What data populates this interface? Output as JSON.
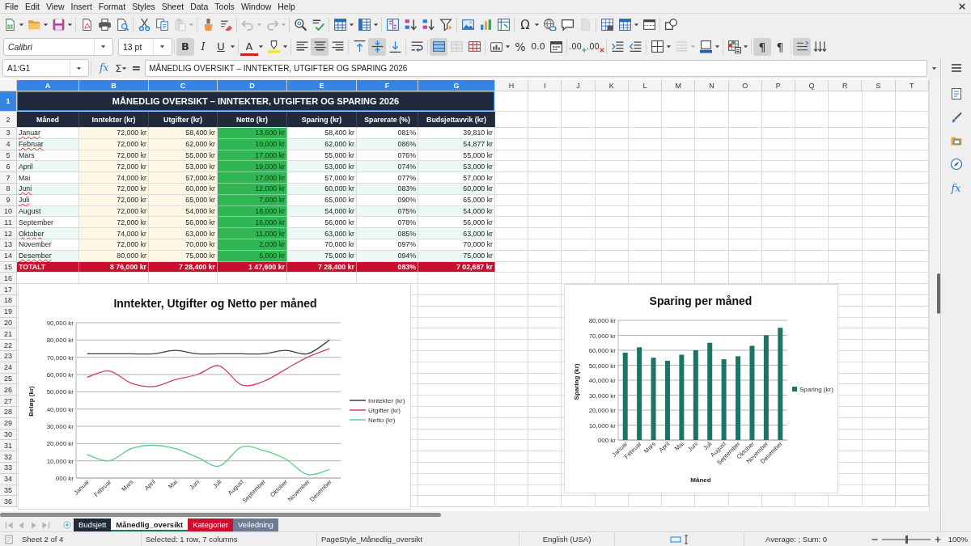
{
  "menu_bar": {
    "items": [
      "File",
      "Edit",
      "View",
      "Insert",
      "Format",
      "Styles",
      "Sheet",
      "Data",
      "Tools",
      "Window",
      "Help"
    ]
  },
  "standard_toolbar": {
    "groups": [
      [
        {
          "kind": "new",
          "dropdown": true,
          "disabled": false
        },
        {
          "kind": "open",
          "dropdown": true,
          "disabled": false
        },
        {
          "kind": "save",
          "dropdown": true,
          "disabled": false
        }
      ],
      [
        {
          "kind": "pdf",
          "disabled": false
        },
        {
          "kind": "print",
          "disabled": false
        },
        {
          "kind": "preview",
          "disabled": false
        }
      ],
      [
        {
          "kind": "cut",
          "disabled": false
        },
        {
          "kind": "copy",
          "disabled": false
        },
        {
          "kind": "paste",
          "dropdown": true,
          "disabled": true
        }
      ],
      [
        {
          "kind": "brush",
          "disabled": false
        },
        {
          "kind": "eraser",
          "disabled": false
        }
      ],
      [
        {
          "kind": "undo",
          "dropdown": true,
          "disabled": true
        },
        {
          "kind": "redo",
          "dropdown": true,
          "disabled": true
        }
      ],
      [
        {
          "kind": "find",
          "disabled": false
        },
        {
          "kind": "spelling",
          "disabled": false
        }
      ],
      [
        {
          "kind": "rows",
          "dropdown": true,
          "disabled": false
        },
        {
          "kind": "columns",
          "dropdown": true,
          "disabled": false
        }
      ],
      [
        {
          "kind": "sortaz",
          "disabled": false
        },
        {
          "kind": "ascending",
          "disabled": false
        },
        {
          "kind": "descending",
          "disabled": false
        },
        {
          "kind": "filter",
          "disabled": false
        }
      ],
      [
        {
          "kind": "image",
          "disabled": false
        },
        {
          "kind": "chart",
          "disabled": false
        },
        {
          "kind": "pivot",
          "disabled": false
        }
      ],
      [
        {
          "kind": "special",
          "label": "Ω",
          "dropdown": true,
          "disabled": false
        },
        {
          "kind": "link",
          "disabled": false
        },
        {
          "kind": "comment",
          "disabled": false
        },
        {
          "kind": "header",
          "disabled": true
        }
      ],
      [
        {
          "kind": "printarea",
          "disabled": false
        },
        {
          "kind": "freeze",
          "dropdown": true,
          "disabled": false
        },
        {
          "kind": "split",
          "disabled": false
        }
      ],
      [
        {
          "kind": "shapes",
          "disabled": false
        }
      ]
    ]
  },
  "formatting_toolbar": {
    "font_name": "Calibri",
    "font_size": "13 pt",
    "groups": [
      [
        {
          "kind": "bold",
          "label": "B",
          "on": true,
          "disabled": false
        },
        {
          "kind": "italic",
          "label": "I",
          "on": false,
          "disabled": false
        },
        {
          "kind": "underline",
          "label": "U",
          "dropdown": true,
          "on": false,
          "disabled": false
        }
      ],
      [
        {
          "kind": "fontcolor",
          "label": "A",
          "dropdown": true,
          "on": false,
          "disabled": false
        },
        {
          "kind": "highlight",
          "dropdown": true,
          "on": false,
          "disabled": false
        }
      ],
      [
        {
          "kind": "alignleft",
          "on": false,
          "disabled": false
        },
        {
          "kind": "aligncenter",
          "on": true,
          "disabled": false
        },
        {
          "kind": "alignright",
          "on": false,
          "disabled": false
        }
      ],
      [
        {
          "kind": "aligntop",
          "on": false,
          "disabled": false
        },
        {
          "kind": "alignmiddle",
          "on": true,
          "disabled": false
        },
        {
          "kind": "alignbottom",
          "on": false,
          "disabled": false
        }
      ],
      [
        {
          "kind": "wrap",
          "on": false,
          "disabled": false
        }
      ],
      [
        {
          "kind": "merge",
          "on": true,
          "disabled": false
        },
        {
          "kind": "mergecells",
          "on": false,
          "disabled": true
        },
        {
          "kind": "unmerge",
          "on": false,
          "disabled": false
        }
      ],
      [
        {
          "kind": "numformat",
          "dropdown": true,
          "on": false,
          "disabled": false
        },
        {
          "kind": "percent",
          "label": "%",
          "on": false,
          "disabled": false
        },
        {
          "kind": "standard",
          "label": "0.0",
          "on": false,
          "disabled": false
        },
        {
          "kind": "date",
          "on": false,
          "disabled": false
        }
      ],
      [
        {
          "kind": "adddecimal",
          "label": ".00",
          "on": false,
          "disabled": false
        },
        {
          "kind": "deletedecimal",
          "label": ".00",
          "on": false,
          "disabled": false
        }
      ],
      [
        {
          "kind": "indent",
          "on": false,
          "disabled": false
        },
        {
          "kind": "outdent",
          "on": false,
          "disabled": false
        }
      ],
      [
        {
          "kind": "borders",
          "dropdown": true,
          "on": false,
          "disabled": false
        },
        {
          "kind": "borderstyle",
          "dropdown": true,
          "on": false,
          "disabled": true
        },
        {
          "kind": "bordercolor",
          "dropdown": true,
          "on": false,
          "disabled": false
        }
      ],
      [
        {
          "kind": "conditional",
          "dropdown": true,
          "on": false,
          "disabled": false
        }
      ],
      [
        {
          "kind": "ltr",
          "label": "¶",
          "on": true,
          "disabled": false
        },
        {
          "kind": "rtl",
          "label": "¶",
          "on": false,
          "disabled": false
        }
      ],
      [
        {
          "kind": "textdir",
          "on": true,
          "disabled": false
        },
        {
          "kind": "vertical",
          "on": false,
          "disabled": false
        }
      ]
    ]
  },
  "formula_bar": {
    "name_box": "A1:G1",
    "function_wizard": "fx",
    "sum": "Σ",
    "equals": "=",
    "content": "MÅNEDLIG OVERSIKT – INNTEKTER, UTGIFTER OG SPARING 2026"
  },
  "sidebar": {
    "buttons": [
      {
        "kind": "menu"
      },
      {
        "kind": "properties",
        "selected": false
      },
      {
        "kind": "styles",
        "selected": false
      },
      {
        "kind": "gallery",
        "selected": false
      },
      {
        "kind": "navigator",
        "selected": false
      },
      {
        "kind": "functions",
        "label": "fx",
        "selected": false
      }
    ]
  },
  "sheet": {
    "columns": [
      {
        "label": "A",
        "selected": true
      },
      {
        "label": "B",
        "selected": true
      },
      {
        "label": "C",
        "selected": true
      },
      {
        "label": "D",
        "selected": true
      },
      {
        "label": "E",
        "selected": true
      },
      {
        "label": "F",
        "selected": true
      },
      {
        "label": "G",
        "selected": true
      },
      {
        "label": "H",
        "selected": false
      },
      {
        "label": "I",
        "selected": false
      },
      {
        "label": "J",
        "selected": false
      },
      {
        "label": "K",
        "selected": false
      },
      {
        "label": "L",
        "selected": false
      },
      {
        "label": "M",
        "selected": false
      },
      {
        "label": "N",
        "selected": false
      },
      {
        "label": "O",
        "selected": false
      },
      {
        "label": "P",
        "selected": false
      },
      {
        "label": "Q",
        "selected": false
      },
      {
        "label": "R",
        "selected": false
      },
      {
        "label": "S",
        "selected": false
      },
      {
        "label": "T",
        "selected": false
      }
    ],
    "row_headers": [
      {
        "label": "1",
        "selected": true
      },
      {
        "label": "2",
        "selected": false
      },
      {
        "label": "3",
        "selected": false
      },
      {
        "label": "4",
        "selected": false
      },
      {
        "label": "5",
        "selected": false
      },
      {
        "label": "6",
        "selected": false
      },
      {
        "label": "7",
        "selected": false
      },
      {
        "label": "8",
        "selected": false
      },
      {
        "label": "9",
        "selected": false
      },
      {
        "label": "10",
        "selected": false
      },
      {
        "label": "11",
        "selected": false
      },
      {
        "label": "12",
        "selected": false
      },
      {
        "label": "13",
        "selected": false
      },
      {
        "label": "14",
        "selected": false
      },
      {
        "label": "15",
        "selected": false
      },
      {
        "label": "16",
        "selected": false
      },
      {
        "label": "17",
        "selected": false
      },
      {
        "label": "18",
        "selected": false
      },
      {
        "label": "19",
        "selected": false
      },
      {
        "label": "20",
        "selected": false
      },
      {
        "label": "21",
        "selected": false
      },
      {
        "label": "22",
        "selected": false
      },
      {
        "label": "23",
        "selected": false
      },
      {
        "label": "24",
        "selected": false
      },
      {
        "label": "25",
        "selected": false
      },
      {
        "label": "26",
        "selected": false
      },
      {
        "label": "27",
        "selected": false
      },
      {
        "label": "28",
        "selected": false
      },
      {
        "label": "29",
        "selected": false
      },
      {
        "label": "30",
        "selected": false
      },
      {
        "label": "31",
        "selected": false
      },
      {
        "label": "32",
        "selected": false
      },
      {
        "label": "33",
        "selected": false
      },
      {
        "label": "34",
        "selected": false
      },
      {
        "label": "35",
        "selected": false
      },
      {
        "label": "36",
        "selected": false
      }
    ],
    "title": "MÅNEDLIG OVERSIKT – INNTEKTER, UTGIFTER OG SPARING 2026",
    "headers": [
      "Måned",
      "Inntekter (kr)",
      "Utgifter (kr)",
      "Netto (kr)",
      "Sparing (kr)",
      "Sparerate (%)",
      "Budsjettavvik (kr)"
    ],
    "rows": [
      {
        "cells": [
          "Januar",
          "72,000 kr",
          "58,400 kr",
          "13,600 kr",
          "58,400 kr",
          "081%",
          "39,810 kr"
        ],
        "spelling_flagged": true
      },
      {
        "cells": [
          "Februar",
          "72,000 kr",
          "62,000 kr",
          "10,000 kr",
          "62,000 kr",
          "086%",
          "54,877 kr"
        ],
        "spelling_flagged": true
      },
      {
        "cells": [
          "Mars",
          "72,000 kr",
          "55,000 kr",
          "17,000 kr",
          "55,000 kr",
          "076%",
          "55,000 kr"
        ],
        "spelling_flagged": false
      },
      {
        "cells": [
          "April",
          "72,000 kr",
          "53,000 kr",
          "19,000 kr",
          "53,000 kr",
          "074%",
          "53,000 kr"
        ],
        "spelling_flagged": false
      },
      {
        "cells": [
          "Mai",
          "74,000 kr",
          "57,000 kr",
          "17,000 kr",
          "57,000 kr",
          "077%",
          "57,000 kr"
        ],
        "spelling_flagged": false
      },
      {
        "cells": [
          "Juni",
          "72,000 kr",
          "60,000 kr",
          "12,000 kr",
          "60,000 kr",
          "083%",
          "60,000 kr"
        ],
        "spelling_flagged": true
      },
      {
        "cells": [
          "Juli",
          "72,000 kr",
          "65,000 kr",
          "7,000 kr",
          "65,000 kr",
          "090%",
          "65,000 kr"
        ],
        "spelling_flagged": true
      },
      {
        "cells": [
          "August",
          "72,000 kr",
          "54,000 kr",
          "18,000 kr",
          "54,000 kr",
          "075%",
          "54,000 kr"
        ],
        "spelling_flagged": false
      },
      {
        "cells": [
          "September",
          "72,000 kr",
          "56,000 kr",
          "16,000 kr",
          "56,000 kr",
          "078%",
          "56,000 kr"
        ],
        "spelling_flagged": false
      },
      {
        "cells": [
          "Oktober",
          "74,000 kr",
          "63,000 kr",
          "11,000 kr",
          "63,000 kr",
          "085%",
          "63,000 kr"
        ],
        "spelling_flagged": true
      },
      {
        "cells": [
          "November",
          "72,000 kr",
          "70,000 kr",
          "2,000 kr",
          "70,000 kr",
          "097%",
          "70,000 kr"
        ],
        "spelling_flagged": false
      },
      {
        "cells": [
          "Desember",
          "80,000 kr",
          "75,000 kr",
          "5,000 kr",
          "75,000 kr",
          "094%",
          "75,000 kr"
        ],
        "spelling_flagged": true
      }
    ],
    "total": [
      "TOTALT",
      "8 76,000 kr",
      "7 28,400 kr",
      "1 47,600 kr",
      "7 28,400 kr",
      "083%",
      "7 02,687 kr"
    ]
  },
  "charts": [
    {
      "chart_data": {
        "type": "line",
        "title": "Inntekter, Utgifter og Netto per måned",
        "ylabel": "Beløp (kr)",
        "categories": [
          "Januar",
          "Februar",
          "Mars",
          "April",
          "Mai",
          "Juni",
          "Juli",
          "August",
          "September",
          "Oktober",
          "November",
          "Desember"
        ],
        "series": [
          {
            "name": "Inntekter (kr)",
            "color": "#3b3f4a",
            "values": [
              72000,
              72000,
              72000,
              72000,
              74000,
              72000,
              72000,
              72000,
              72000,
              74000,
              72000,
              80000
            ]
          },
          {
            "name": "Utgifter (kr)",
            "color": "#d0435a",
            "values": [
              58400,
              62000,
              55000,
              53000,
              57000,
              60000,
              65000,
              54000,
              56000,
              63000,
              70000,
              75000
            ]
          },
          {
            "name": "Netto (kr)",
            "color": "#5ccf85",
            "values": [
              13600,
              10000,
              17000,
              19000,
              17000,
              12000,
              7000,
              18000,
              16000,
              11000,
              2000,
              5000
            ]
          }
        ],
        "ylim": [
          0,
          90000
        ],
        "yticks": [
          {
            "value": 0,
            "label": "000 kr"
          },
          {
            "value": 10000,
            "label": "10,000 kr"
          },
          {
            "value": 20000,
            "label": "20,000 kr"
          },
          {
            "value": 30000,
            "label": "30,000 kr"
          },
          {
            "value": 40000,
            "label": "40,000 kr"
          },
          {
            "value": 50000,
            "label": "50,000 kr"
          },
          {
            "value": 60000,
            "label": "60,000 kr"
          },
          {
            "value": 70000,
            "label": "70,000 kr"
          },
          {
            "value": 80000,
            "label": "80,000 kr"
          },
          {
            "value": 90000,
            "label": "90,000 kr"
          }
        ],
        "grid": true,
        "legend": "right"
      }
    },
    {
      "chart_data": {
        "type": "bar",
        "title": "Sparing per måned",
        "xlabel": "Måned",
        "ylabel": "Sparing (kr)",
        "categories": [
          "Januar",
          "Februar",
          "Mars",
          "April",
          "Mai",
          "Juni",
          "Juli",
          "August",
          "September",
          "Oktober",
          "November",
          "Desember"
        ],
        "series": [
          {
            "name": "Sparing (kr)",
            "color": "#1a7565",
            "values": [
              58400,
              62000,
              55000,
              53000,
              57000,
              60000,
              65000,
              54000,
              56000,
              63000,
              70000,
              75000
            ]
          }
        ],
        "ylim": [
          0,
          80000
        ],
        "yticks": [
          {
            "value": 0,
            "label": "000 kr"
          },
          {
            "value": 10000,
            "label": "10,000 kr"
          },
          {
            "value": 20000,
            "label": "20,000 kr"
          },
          {
            "value": 30000,
            "label": "30,000 kr"
          },
          {
            "value": 40000,
            "label": "40,000 kr"
          },
          {
            "value": 50000,
            "label": "50,000 kr"
          },
          {
            "value": 60000,
            "label": "60,000 kr"
          },
          {
            "value": 70000,
            "label": "70,000 kr"
          },
          {
            "value": 80000,
            "label": "80,000 kr"
          }
        ],
        "grid": true,
        "legend": "right"
      }
    }
  ],
  "sheet_tabs": {
    "navigation": [
      {
        "kind": "first",
        "disabled": true
      },
      {
        "kind": "previous",
        "disabled": true
      },
      {
        "kind": "next",
        "disabled": true
      },
      {
        "kind": "last",
        "disabled": true
      }
    ],
    "tabs": [
      {
        "label": "Budsjett",
        "color": "#1f2b3c",
        "selected": false
      },
      {
        "label": "Månedlig_oversikt",
        "color": "#1a7565",
        "selected": true
      },
      {
        "label": "Kategorier",
        "color": "#c8102e",
        "selected": false
      },
      {
        "label": "Veiledning",
        "color": "#6a7d95",
        "selected": false
      }
    ]
  },
  "status_bar": {
    "sheet_position": "Sheet 2 of 4",
    "selection": "Selected: 1 row, 7 columns",
    "page_style": "PageStyle_Månedlig_oversikt",
    "language": "English (USA)",
    "statistics": "Average: ; Sum: 0",
    "zoom": {
      "level": 0.5,
      "reading": "100%"
    }
  }
}
